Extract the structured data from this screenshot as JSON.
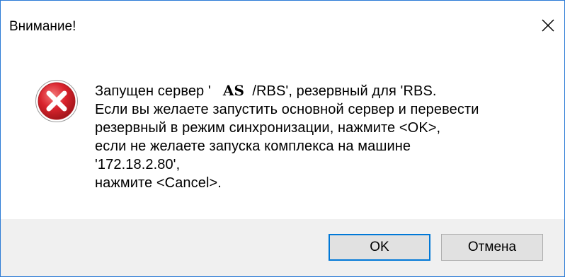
{
  "window": {
    "title": "Внимание!",
    "close_icon": "close-icon"
  },
  "message": {
    "icon": "error-icon",
    "line1_prefix": "Запущен сервер '",
    "line1_bold": "AS",
    "line1_suffix": "/RBS', резервный для 'RBS.",
    "line2": "Если вы желаете запустить основной сервер и перевести",
    "line3": "резервный в режим синхронизации, нажмите <OK>,",
    "line4": "если не желаете запуска комплекса на машине",
    "line5": "'172.18.2.80',",
    "line6": "нажмите <Cancel>."
  },
  "buttons": {
    "ok_label": "OK",
    "cancel_label": "Отмена"
  },
  "colors": {
    "accent": "#0078d7",
    "footer_bg": "#f0f0f0",
    "error_red": "#d9232d"
  }
}
